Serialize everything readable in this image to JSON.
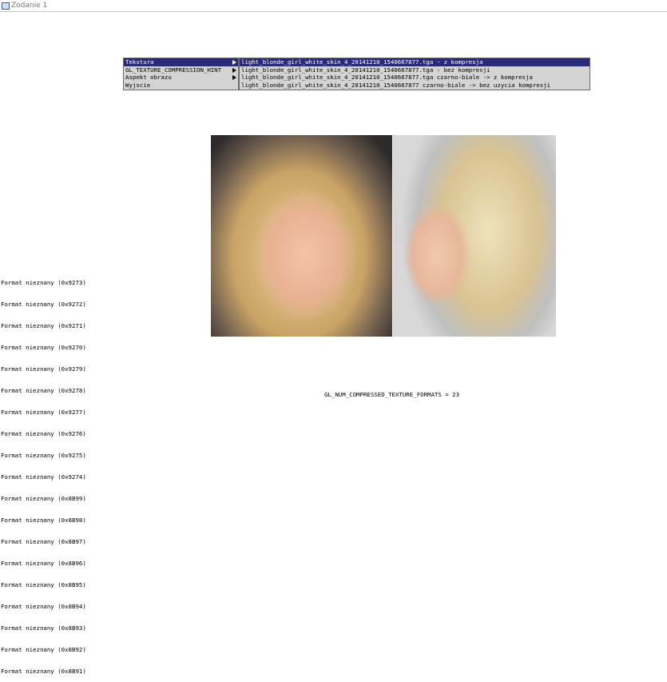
{
  "window": {
    "title": "Zodanie 1",
    "icon": "app-window-icon"
  },
  "menu": {
    "items": [
      {
        "label": "Tekstura",
        "selected": true,
        "has_submenu": true
      },
      {
        "label": "GL_TEXTURE_COMPRESSION_HINT",
        "selected": false,
        "has_submenu": true
      },
      {
        "label": "Aspekt obrazu",
        "selected": false,
        "has_submenu": true
      },
      {
        "label": "Wyjscie",
        "selected": false,
        "has_submenu": false
      }
    ]
  },
  "submenu": {
    "items": [
      {
        "label": "light_blonde_girl_white_skin_4_20141210_1540667877.tga - z kompresja",
        "selected": true
      },
      {
        "label": "light_blonde_girl_white_skin_4_20141210_1540667877.tga  - bez kompresji",
        "selected": false
      },
      {
        "label": "light_blonde_girl_white_skin_4_20141210_1540667877.tga czarno-biale -> z kompresja",
        "selected": false
      },
      {
        "label": "light_blonde_girl_white_skin_4_20141210_1540667877 czarno-biale -> bez uzycia kompresji",
        "selected": false
      }
    ]
  },
  "log": {
    "lines": [
      "Format nieznany (0x9273)",
      "Format nieznany (0x9272)",
      "Format nieznany (0x9271)",
      "Format nieznany (0x9270)",
      "Format nieznany (0x9279)",
      "Format nieznany (0x9278)",
      "Format nieznany (0x9277)",
      "Format nieznany (0x9276)",
      "Format nieznany (0x9275)",
      "Format nieznany (0x9274)",
      "Format nieznany (0x8B99)",
      "Format nieznany (0x8B98)",
      "Format nieznany (0x8B97)",
      "Format nieznany (0x8B96)",
      "Format nieznany (0x8B95)",
      "Format nieznany (0x8B94)",
      "Format nieznany (0x8B93)",
      "Format nieznany (0x8B92)",
      "Format nieznany (0x8B91)"
    ]
  },
  "status": {
    "text": "GL_NUM_COMPRESSED_TEXTURE_FORMATS = 23"
  },
  "colors": {
    "menu_bg": "#d4d4d4",
    "menu_selected": "#2a2a7a",
    "menu_selected_text": "#ffffff"
  }
}
